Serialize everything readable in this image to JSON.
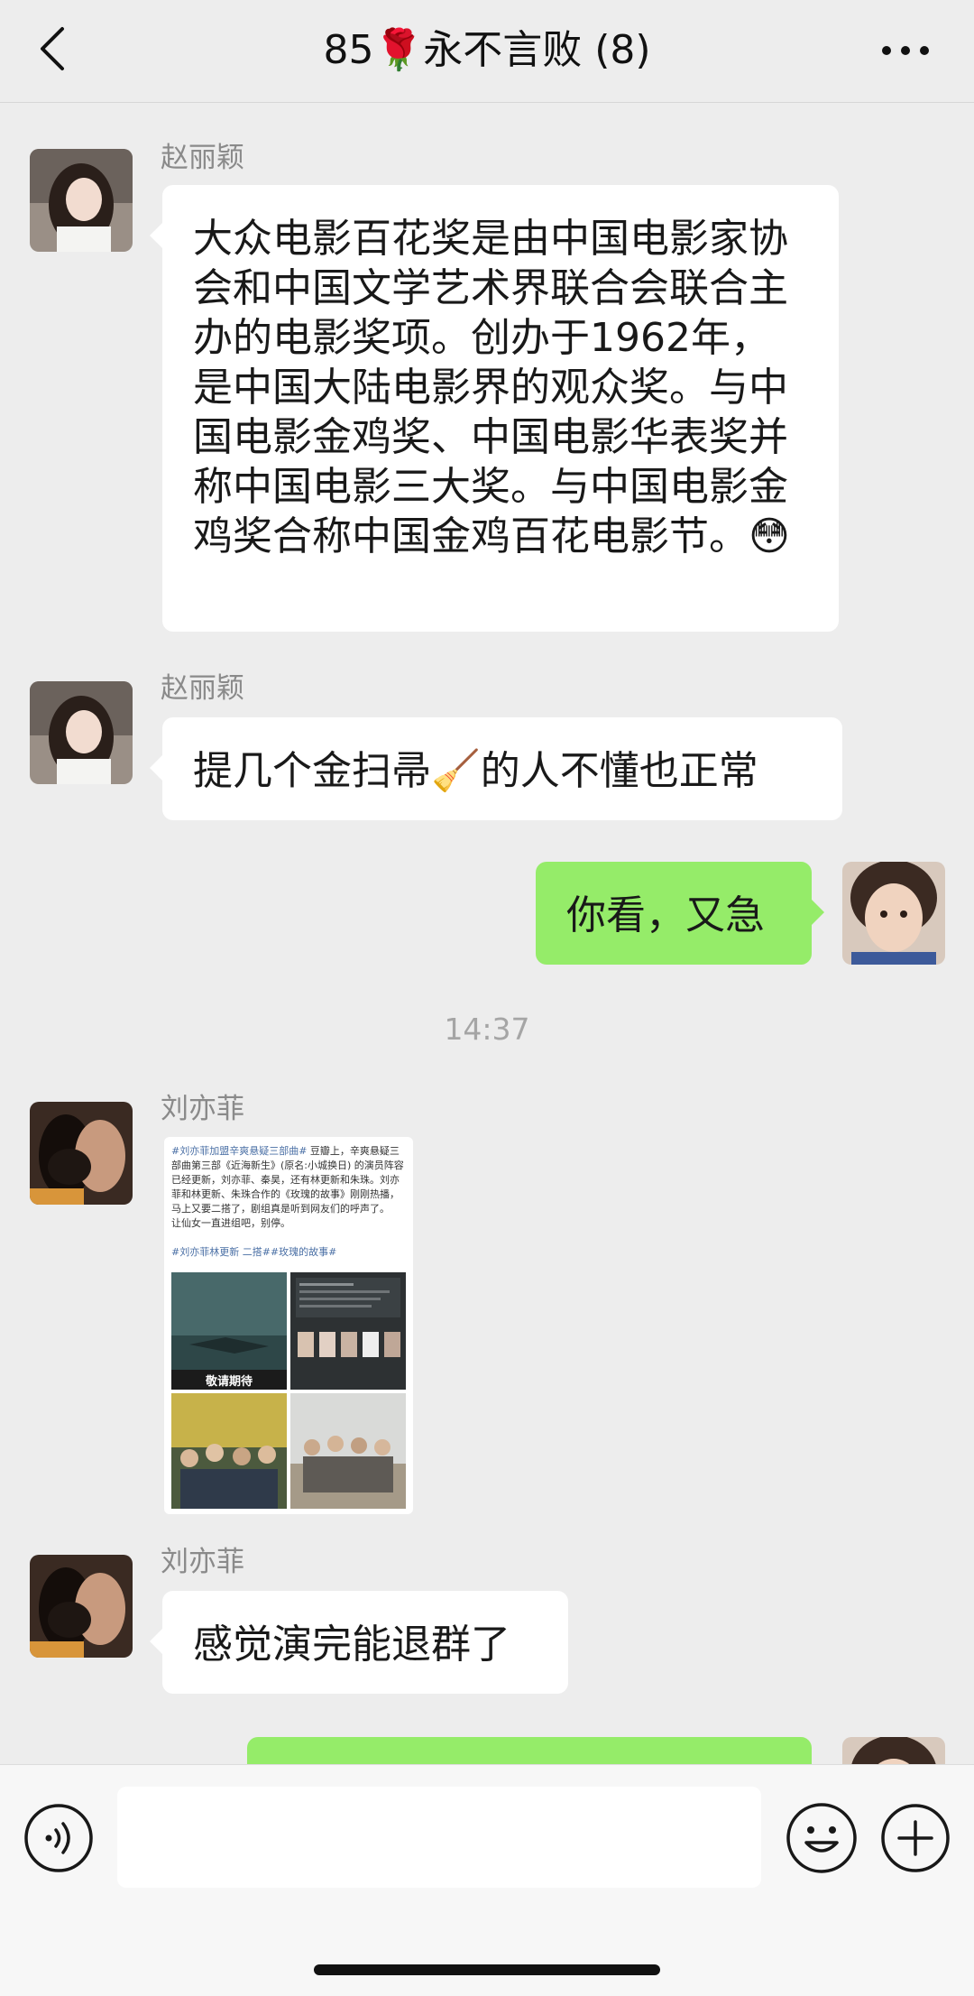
{
  "header": {
    "title": "85🌹永不言败 (8)",
    "back_icon": "chevron-left-icon",
    "more_icon": "more-dots-icon"
  },
  "messages": [
    {
      "sender": "赵丽颖",
      "side": "left",
      "text": "大众电影百花奖是由中国电影家协会和中国文学艺术界联合会联合主办的电影奖项。创办于1962年，是中国大陆电影界的观众奖。与中国电影金鸡奖、中国电影华表奖并称中国电影三大奖。与中国电影金鸡奖合称中国金鸡百花电影节。😳"
    },
    {
      "sender": "赵丽颖",
      "side": "left",
      "text": "提几个金扫帚🧹的人不懂也正常"
    },
    {
      "side": "right",
      "text": "你看，又急"
    },
    {
      "type": "time",
      "text": "14:37"
    },
    {
      "sender": "刘亦菲",
      "side": "left",
      "type": "image",
      "post_text_1": "#刘亦菲加盟辛爽悬疑三部曲#",
      "post_text_2": " 豆瓣上，辛爽悬疑三部曲第三部《近海新生》(原名:小城换日) 的演员阵容已经更新，刘亦菲、秦昊，还有林更新和朱珠。刘亦菲和林更新、朱珠合作的《玫瑰的故事》刚刚热播，马上又要二搭了，剧组真是听到网友们的呼声了。",
      "post_text_3": "让仙女一直进组吧，别停。",
      "post_tags": "#刘亦菲林更新 二搭##玫瑰的故事#",
      "poster_caption": "敬请期待"
    },
    {
      "sender": "刘亦菲",
      "side": "left",
      "text": "感觉演完能退群了"
    }
  ],
  "input_bar": {
    "voice_icon": "voice-icon",
    "emoji_icon": "emoji-icon",
    "plus_icon": "plus-icon",
    "placeholder": ""
  },
  "colors": {
    "background": "#ededed",
    "bubble_self": "#95ec69",
    "bubble_other": "#ffffff"
  }
}
